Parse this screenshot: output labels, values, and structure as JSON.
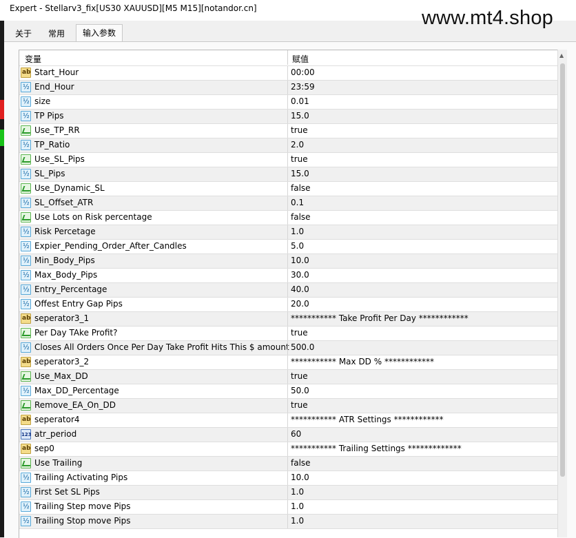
{
  "window": {
    "title": "Expert - Stellarv3_fix[US30 XAUUSD][M5 M15][notandor.cn]"
  },
  "watermark": "www.mt4.shop",
  "tabs": [
    {
      "label": "关于",
      "active": false
    },
    {
      "label": "常用",
      "active": false
    },
    {
      "label": "输入参数",
      "active": true
    }
  ],
  "table": {
    "headers": {
      "name": "变量",
      "value": "赋值"
    },
    "rows": [
      {
        "icon": "ab-icon",
        "name": "Start_Hour",
        "value": "00:00"
      },
      {
        "icon": "v2-icon",
        "name": "End_Hour",
        "value": "23:59"
      },
      {
        "icon": "v2-icon",
        "name": "size",
        "value": "0.01"
      },
      {
        "icon": "v2-icon",
        "name": "TP Pips",
        "value": "15.0"
      },
      {
        "icon": "tf-icon",
        "name": "Use_TP_RR",
        "value": "true"
      },
      {
        "icon": "v2-icon",
        "name": "TP_Ratio",
        "value": "2.0"
      },
      {
        "icon": "tf-icon",
        "name": "Use_SL_Pips",
        "value": "true"
      },
      {
        "icon": "v2-icon",
        "name": "SL_Pips",
        "value": "15.0"
      },
      {
        "icon": "tf-icon",
        "name": "Use_Dynamic_SL",
        "value": "false"
      },
      {
        "icon": "v2-icon",
        "name": "SL_Offset_ATR",
        "value": "0.1"
      },
      {
        "icon": "tf-icon",
        "name": "Use Lots on Risk percentage",
        "value": "false"
      },
      {
        "icon": "v2-icon",
        "name": "Risk Percetage",
        "value": "1.0"
      },
      {
        "icon": "v2-icon",
        "name": "Expier_Pending_Order_After_Candles",
        "value": "5.0"
      },
      {
        "icon": "v2-icon",
        "name": "Min_Body_Pips",
        "value": "10.0"
      },
      {
        "icon": "v2-icon",
        "name": "Max_Body_Pips",
        "value": "30.0"
      },
      {
        "icon": "v2-icon",
        "name": "Entry_Percentage",
        "value": "40.0"
      },
      {
        "icon": "v2-icon",
        "name": "Offest Entry Gap Pips",
        "value": "20.0"
      },
      {
        "icon": "ab-icon",
        "name": "seperator3_1",
        "value": " ***********   Take Profit Per Day   ************"
      },
      {
        "icon": "tf-icon",
        "name": "Per Day TAke Profit?",
        "value": "true"
      },
      {
        "icon": "v2-icon",
        "name": "Closes All Orders Once Per Day Take Profit Hits This $ amount",
        "value": "500.0"
      },
      {
        "icon": "ab-icon",
        "name": "seperator3_2",
        "value": " ***********   Max DD %   ************"
      },
      {
        "icon": "tf-icon",
        "name": "Use_Max_DD",
        "value": "true"
      },
      {
        "icon": "v2-icon",
        "name": "Max_DD_Percentage",
        "value": "50.0"
      },
      {
        "icon": "tf-icon",
        "name": "Remove_EA_On_DD",
        "value": "true"
      },
      {
        "icon": "ab-icon",
        "name": "seperator4",
        "value": " ***********   ATR Settings   ************"
      },
      {
        "icon": "123-icon",
        "name": "atr_period",
        "value": "60"
      },
      {
        "icon": "ab-icon",
        "name": "sep0",
        "value": " *********** Trailing Settings *************"
      },
      {
        "icon": "tf-icon",
        "name": "Use Trailing",
        "value": "false"
      },
      {
        "icon": "v2-icon",
        "name": "Trailing Activating Pips",
        "value": "10.0"
      },
      {
        "icon": "v2-icon",
        "name": "First Set SL  Pips",
        "value": "1.0"
      },
      {
        "icon": "v2-icon",
        "name": "Trailing Step move Pips",
        "value": "1.0"
      },
      {
        "icon": "v2-icon",
        "name": "Trailing Stop move Pips",
        "value": "1.0"
      }
    ]
  }
}
